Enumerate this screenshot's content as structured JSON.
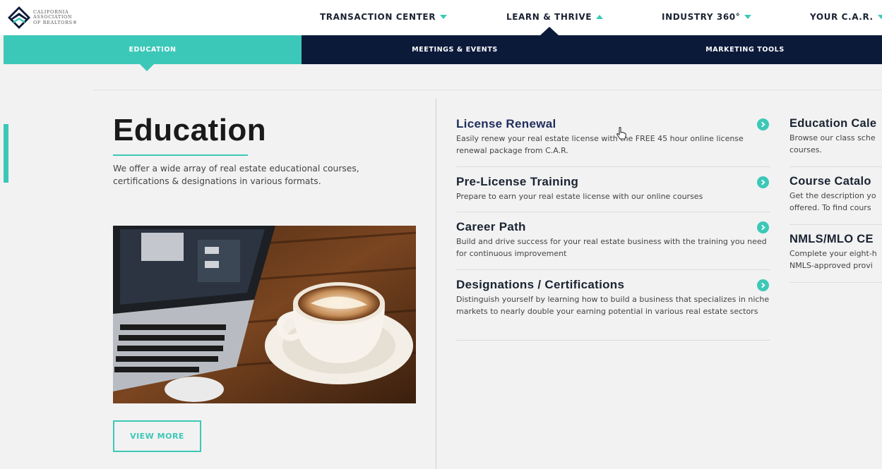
{
  "logo": {
    "line1": "CALIFORNIA",
    "line2": "ASSOCIATION",
    "line3": "OF REALTORS®"
  },
  "topnav": [
    {
      "label": "TRANSACTION CENTER",
      "caret": "down"
    },
    {
      "label": "LEARN & THRIVE",
      "caret": "up"
    },
    {
      "label": "INDUSTRY 360°",
      "caret": "down"
    },
    {
      "label": "YOUR C.A.R.",
      "caret": "down"
    }
  ],
  "subnav": {
    "education": "EDUCATION",
    "meetings": "MEETINGS & EVENTS",
    "marketing": "MARKETING TOOLS"
  },
  "hero": {
    "title": "Education",
    "description": "We offer a wide array of real estate educational courses, certifications & designations in various formats.",
    "button": "VIEW MORE"
  },
  "items": [
    {
      "title": "License Renewal",
      "desc": "Easily renew your real estate license with the FREE 45 hour online license renewal package from C.A.R."
    },
    {
      "title": "Pre-License Training",
      "desc": "Prepare to earn your real estate license with our online courses"
    },
    {
      "title": "Career Path",
      "desc": "Build and drive success for your real estate business with the training you need for continuous improvement"
    },
    {
      "title": "Designations / Certifications",
      "desc": "Distinguish yourself by learning how to build a business that specializes in niche markets to nearly double your earning potential in various real estate sectors"
    }
  ],
  "col3": [
    {
      "title": "Education Cale",
      "desc1": "Browse our class sche",
      "desc2": "courses."
    },
    {
      "title": "Course Catalo",
      "desc1": "Get the description yo",
      "desc2": "offered.  To find cours"
    },
    {
      "title": "NMLS/MLO CE",
      "desc1": "Complete your eight-h",
      "desc2": "NMLS-approved provi"
    }
  ],
  "colors": {
    "teal": "#3cc8b8",
    "navy": "#0c1a3a"
  }
}
